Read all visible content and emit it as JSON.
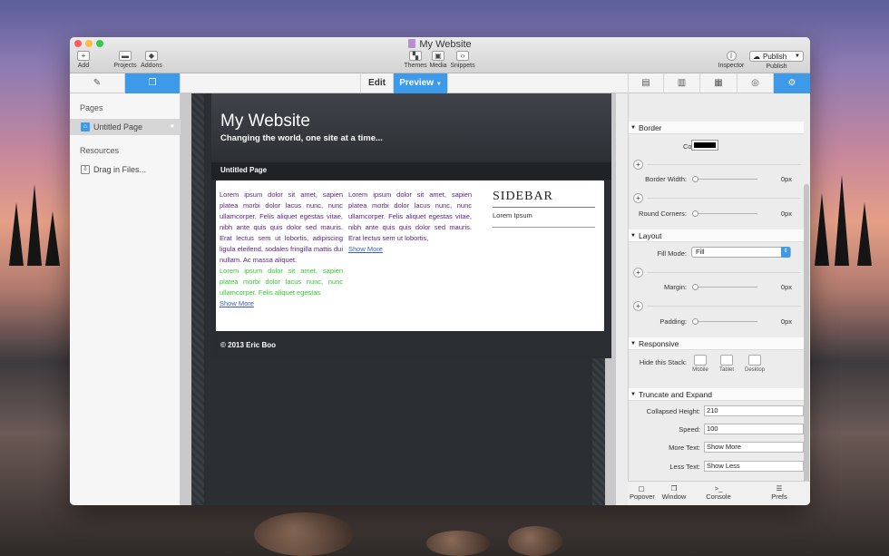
{
  "window": {
    "title": "My Website"
  },
  "toolbar": {
    "add": "Add",
    "projects": "Projects",
    "addons": "Addons",
    "themes": "Themes",
    "media": "Media",
    "snippets": "Snippets",
    "inspector": "Inspector",
    "publish_button": "Publish",
    "publish": "Publish"
  },
  "tabs": {
    "edit": "Edit",
    "preview": "Preview"
  },
  "sidebar": {
    "pages_header": "Pages",
    "page_item": "Untitled Page",
    "resources_header": "Resources",
    "resources_item": "Drag in Files..."
  },
  "site": {
    "title": "My Website",
    "tagline": "Changing the world, one site at a time...",
    "nav": "Untitled Page",
    "col1": "Lorem ipsum dolor sit amet, sapien platea morbi dolor lacus nunc, nunc ullamcorper. Felis aliquet egestas vitae, nibh ante quis quis dolor sed mauris. Erat lectus sem ut lobortis, adipiscing ligula eleifend, sodales fringilla mattis dui nullam. Ac massa aliquet.",
    "col1_green": "Lorem ipsum dolor sit amet, sapien platea morbi dolor lacus nunc, nunc ullamcorper. Felis aliquet egestas",
    "col2": "Lorem ipsum dolor sit amet, sapien platea morbi dolor lacus nunc, nunc ullamcorper. Felis aliquet egestas vitae, nibh ante quis quis dolor sed mauris. Erat lectus sem ut lobortis,",
    "show_more": "Show More",
    "sidebar_title": "SIDEBAR",
    "sidebar_text": "Lorem Ipsum",
    "footer": "© 2013 Eric Boo"
  },
  "inspector": {
    "border": {
      "title": "Border",
      "color_label": "Color:",
      "border_width_label": "Border Width:",
      "border_width": "0px",
      "round_corners_label": "Round Corners:",
      "round_corners": "0px",
      "color_value": "#000000"
    },
    "layout": {
      "title": "Layout",
      "fill_mode_label": "Fill Mode:",
      "fill_mode": "Fill",
      "margin_label": "Margin:",
      "margin": "0px",
      "padding_label": "Padding:",
      "padding": "0px"
    },
    "responsive": {
      "title": "Responsive",
      "hide_label": "Hide this Stack:",
      "mobile": "Mobile",
      "tablet": "Tablet",
      "desktop": "Desktop"
    },
    "truncate": {
      "title": "Truncate and Expand",
      "collapsed_label": "Collapsed Height:",
      "collapsed": "210",
      "speed_label": "Speed:",
      "speed": "100",
      "more_label": "More Text:",
      "more": "Show More",
      "less_label": "Less Text:",
      "less": "Show Less"
    }
  },
  "bottom": {
    "popover": "Popover",
    "window": "Window",
    "console": "Console",
    "prefs": "Prefs"
  },
  "colors": {
    "accent": "#3d9ae8",
    "close": "#fc605c",
    "minimize": "#fdbc40",
    "zoom": "#34c84a"
  }
}
